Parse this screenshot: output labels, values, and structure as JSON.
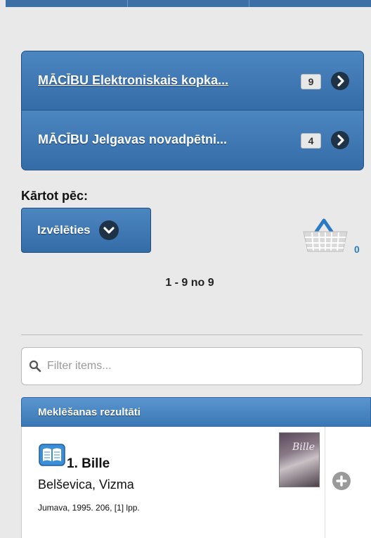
{
  "databases": [
    {
      "label": "MĀCĪBU Elektroniskais kopka...",
      "count": "9"
    },
    {
      "label": "MĀCĪBU Jelgavas novadpētni...",
      "count": "4"
    }
  ],
  "sort": {
    "label": "Kārtot pēc:",
    "button": "Izvēlēties"
  },
  "basket": {
    "count": "0"
  },
  "pager": {
    "text": "1 - 9 no 9"
  },
  "filter": {
    "placeholder": "Filter items..."
  },
  "results": {
    "header": "Meklēšanas rezultāti",
    "items": [
      {
        "title": "1. Bille",
        "author": "Belševica, Vizma",
        "publication": "Jumava, 1995. 206, [1] lpp.",
        "cover_title": "Bille"
      }
    ]
  },
  "colors": {
    "accent": "#3a73ad",
    "dark_icon": "#1f3347",
    "basket_count": "#2a7bc4"
  }
}
